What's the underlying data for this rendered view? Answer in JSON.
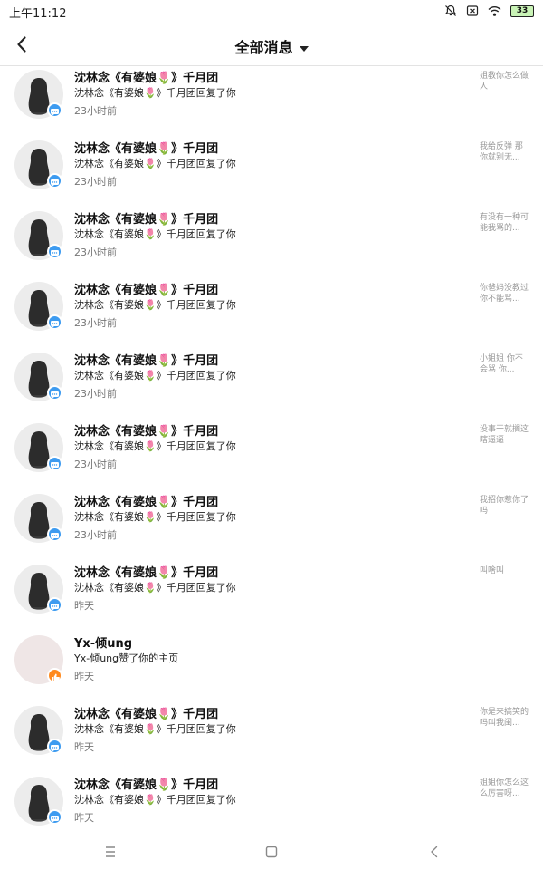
{
  "status": {
    "time": "上午11:12",
    "battery": "33"
  },
  "header": {
    "title": "全部消息"
  },
  "messages": [
    {
      "name": "沈林念《有婆娘🌷》千月团",
      "action": "沈林念《有婆娘🌷》千月团回复了你",
      "time": "23小时前",
      "preview": "姐教你怎么做人",
      "badge": "comment-badge-icon",
      "avatar": "avatar-silhouette"
    },
    {
      "name": "沈林念《有婆娘🌷》千月团",
      "action": "沈林念《有婆娘🌷》千月团回复了你",
      "time": "23小时前",
      "preview": "我给反弹 那你就别无...",
      "badge": "comment-badge-icon",
      "avatar": "avatar-silhouette"
    },
    {
      "name": "沈林念《有婆娘🌷》千月团",
      "action": "沈林念《有婆娘🌷》千月团回复了你",
      "time": "23小时前",
      "preview": "有没有一种可能我骂的...",
      "badge": "comment-badge-icon",
      "avatar": "avatar-silhouette"
    },
    {
      "name": "沈林念《有婆娘🌷》千月团",
      "action": "沈林念《有婆娘🌷》千月团回复了你",
      "time": "23小时前",
      "preview": "你爸妈没教过你不能骂...",
      "badge": "comment-badge-icon",
      "avatar": "avatar-silhouette"
    },
    {
      "name": "沈林念《有婆娘🌷》千月团",
      "action": "沈林念《有婆娘🌷》千月团回复了你",
      "time": "23小时前",
      "preview": "小姐姐 你不会骂 你...",
      "badge": "comment-badge-icon",
      "avatar": "avatar-silhouette"
    },
    {
      "name": "沈林念《有婆娘🌷》千月团",
      "action": "沈林念《有婆娘🌷》千月团回复了你",
      "time": "23小时前",
      "preview": "没事干就搁这瞎逼逼",
      "badge": "comment-badge-icon",
      "avatar": "avatar-silhouette"
    },
    {
      "name": "沈林念《有婆娘🌷》千月团",
      "action": "沈林念《有婆娘🌷》千月团回复了你",
      "time": "23小时前",
      "preview": "我招你惹你了吗",
      "badge": "comment-badge-icon",
      "avatar": "avatar-silhouette"
    },
    {
      "name": "沈林念《有婆娘🌷》千月团",
      "action": "沈林念《有婆娘🌷》千月团回复了你",
      "time": "昨天",
      "preview": "叫啥叫",
      "badge": "comment-badge-icon",
      "avatar": "avatar-silhouette"
    },
    {
      "name": "Yx-倾ung",
      "action": "Yx-倾ung赞了你的主页",
      "time": "昨天",
      "preview": "",
      "badge": "like-badge-icon",
      "avatar": "avatar-plain"
    },
    {
      "name": "沈林念《有婆娘🌷》千月团",
      "action": "沈林念《有婆娘🌷》千月团回复了你",
      "time": "昨天",
      "preview": "你是来搞笑的吗叫我闺...",
      "badge": "comment-badge-icon",
      "avatar": "avatar-silhouette"
    },
    {
      "name": "沈林念《有婆娘🌷》千月团",
      "action": "沈林念《有婆娘🌷》千月团回复了你",
      "time": "昨天",
      "preview": "姐姐你怎么这么厉害呀...",
      "badge": "comment-badge-icon",
      "avatar": "avatar-silhouette"
    }
  ],
  "icons": {
    "back": "chevron-left-icon",
    "dropdown": "caret-down-icon",
    "system_nav": [
      "menu-icon",
      "home-square-icon",
      "back-triangle-icon"
    ]
  },
  "colors": {
    "comment_badge": "#3d9bf0",
    "like_badge": "#ff8a1f"
  }
}
